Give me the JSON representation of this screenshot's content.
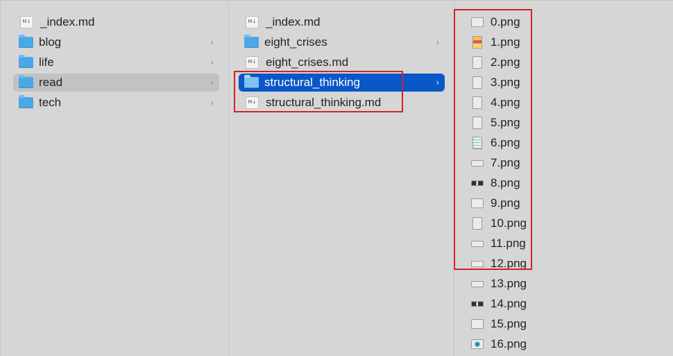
{
  "columns": {
    "col1": {
      "items": [
        {
          "label": "_index.md",
          "type": "markdown"
        },
        {
          "label": "blog",
          "type": "folder"
        },
        {
          "label": "life",
          "type": "folder"
        },
        {
          "label": "read",
          "type": "folder",
          "selected": "inactive"
        },
        {
          "label": "tech",
          "type": "folder"
        }
      ]
    },
    "col2": {
      "items": [
        {
          "label": "_index.md",
          "type": "markdown"
        },
        {
          "label": "eight_crises",
          "type": "folder"
        },
        {
          "label": "eight_crises.md",
          "type": "markdown"
        },
        {
          "label": "structural_thinking",
          "type": "folder",
          "selected": "active"
        },
        {
          "label": "structural_thinking.md",
          "type": "markdown"
        }
      ]
    },
    "col3": {
      "items": [
        {
          "label": "0.png",
          "icon": "image-thumbnail-icon"
        },
        {
          "label": "1.png",
          "icon": "image-thumbnail-icon"
        },
        {
          "label": "2.png",
          "icon": "image-thumbnail-icon"
        },
        {
          "label": "3.png",
          "icon": "image-thumbnail-icon"
        },
        {
          "label": "4.png",
          "icon": "image-thumbnail-icon"
        },
        {
          "label": "5.png",
          "icon": "image-thumbnail-icon"
        },
        {
          "label": "6.png",
          "icon": "image-thumbnail-icon"
        },
        {
          "label": "7.png",
          "icon": "image-thumbnail-icon"
        },
        {
          "label": "8.png",
          "icon": "image-thumbnail-icon"
        },
        {
          "label": "9.png",
          "icon": "image-thumbnail-icon"
        },
        {
          "label": "10.png",
          "icon": "image-thumbnail-icon"
        },
        {
          "label": "11.png",
          "icon": "image-thumbnail-icon"
        },
        {
          "label": "12.png",
          "icon": "image-thumbnail-icon"
        },
        {
          "label": "13.png",
          "icon": "image-thumbnail-icon"
        },
        {
          "label": "14.png",
          "icon": "image-thumbnail-icon"
        },
        {
          "label": "15.png",
          "icon": "image-thumbnail-icon"
        },
        {
          "label": "16.png",
          "icon": "image-thumbnail-icon"
        }
      ]
    }
  },
  "md_icon_text": "M↓",
  "chevron_glyph": "›",
  "colors": {
    "selection_active": "#0a57c9",
    "selection_inactive": "#c2c2c2",
    "folder": "#4aa8e6",
    "highlight_box": "#d81f26"
  }
}
